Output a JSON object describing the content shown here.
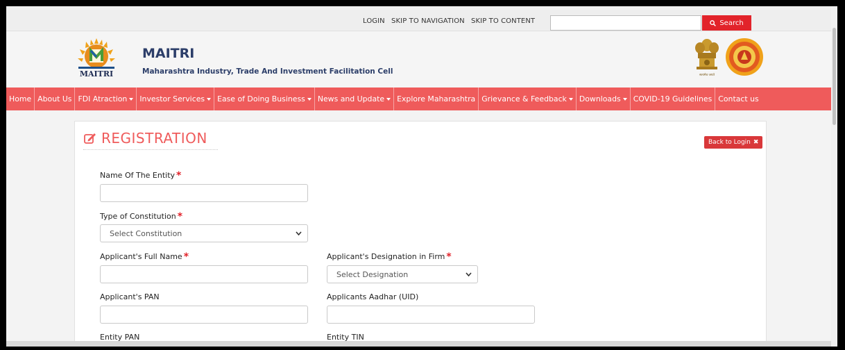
{
  "top_links": [
    "LOGIN",
    "SKIP TO NAVIGATION",
    "SKIP TO CONTENT"
  ],
  "search": {
    "placeholder": "",
    "button_label": "Search"
  },
  "brand": {
    "title": "MAITRI",
    "subtitle": "Maharashtra Industry, Trade And Investment Facilitation Cell",
    "logo_text": "MAITRI",
    "emblem_caption": "सत्यमेव जयते"
  },
  "nav": [
    {
      "label": "Home",
      "dropdown": false
    },
    {
      "label": "About Us",
      "dropdown": false
    },
    {
      "label": "FDI Atraction",
      "dropdown": true
    },
    {
      "label": "Investor Services",
      "dropdown": true
    },
    {
      "label": "Ease of Doing Business",
      "dropdown": true
    },
    {
      "label": "News and Update",
      "dropdown": true
    },
    {
      "label": "Explore Maharashtra",
      "dropdown": false
    },
    {
      "label": "Grievance & Feedback",
      "dropdown": true
    },
    {
      "label": "Downloads",
      "dropdown": true
    },
    {
      "label": "COVID-19 Guidelines",
      "dropdown": false
    },
    {
      "label": "Contact us",
      "dropdown": false
    }
  ],
  "form": {
    "title": "REGISTRATION",
    "back_label": "Back to Login",
    "entity_name": {
      "label": "Name Of The Entity",
      "required": true,
      "value": ""
    },
    "constitution": {
      "label": "Type of Constitution",
      "required": true,
      "selected": "Select Constitution"
    },
    "applicant_name": {
      "label": "Applicant's Full Name",
      "required": true,
      "value": ""
    },
    "designation": {
      "label": "Applicant's Designation in Firm",
      "required": true,
      "selected": "Select Designation"
    },
    "applicant_pan": {
      "label": "Applicant's PAN",
      "value": ""
    },
    "aadhar": {
      "label": "Applicants Aadhar (UID)",
      "value": ""
    },
    "entity_pan": {
      "label": "Entity PAN",
      "value": ""
    },
    "entity_tin": {
      "label": "Entity TIN",
      "value": ""
    }
  },
  "colors": {
    "accent": "#ef5b5b",
    "search_button": "#e2232a",
    "brand_text": "#2c3e69"
  },
  "icons": {
    "search": "search-icon",
    "title": "edit-icon",
    "back": "close-icon",
    "select": "chevron-down-icon"
  }
}
